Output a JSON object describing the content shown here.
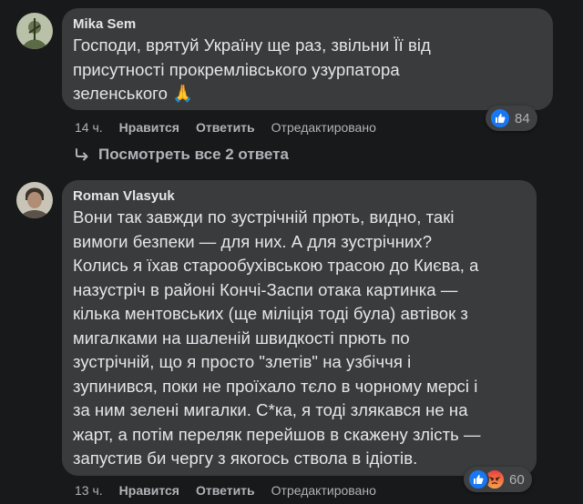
{
  "comments": [
    {
      "author": "Mika Sem",
      "text": "Господи, врятуй Україну ще раз, звільни Її від\nприсутності прокремлівського узурпатора\nзеленського 🙏",
      "time": "14 ч.",
      "like_label": "Нравится",
      "reply_label": "Ответить",
      "edited_label": "Отредактировано",
      "reaction_count": "84",
      "reactions": [
        "like-icon"
      ]
    },
    {
      "author": "Roman Vlasyuk",
      "text": "Вони так завжди по зустрічній прють, видно, такі\nвимоги безпеки — для них. А для зустрічних?\nКолись я їхав старообухівською трасою до Києва, а\nназустріч в районі Кончі-Заспи отака картинка —\nкілька ментовських (ще міліція тоді була) автівок з\nмигалками на шаленій швидкості прють по\nзустрічній, що я просто \"злетів\" на узбіччя і\nзупинився, поки не проїхало тєло в чорному мерсі і\nза ним зелені мигалки. С*ка, я тоді злякався не на\nжарт, а потім переляк перейшов в скажену злість —\nзапустив би чергу з якогось ствола в ідіотів.",
      "time": "13 ч.",
      "like_label": "Нравится",
      "reply_label": "Ответить",
      "edited_label": "Отредактировано",
      "reaction_count": "60",
      "reactions": [
        "like-icon",
        "angry-icon"
      ]
    }
  ],
  "view_replies_label": "Посмотреть все 2 ответа",
  "colors": {
    "background": "#18191a",
    "bubble": "#3a3b3c",
    "secondary_text": "#b0b3b8",
    "like_blue": "#1877f2",
    "angry_orange": "#f7714c"
  }
}
